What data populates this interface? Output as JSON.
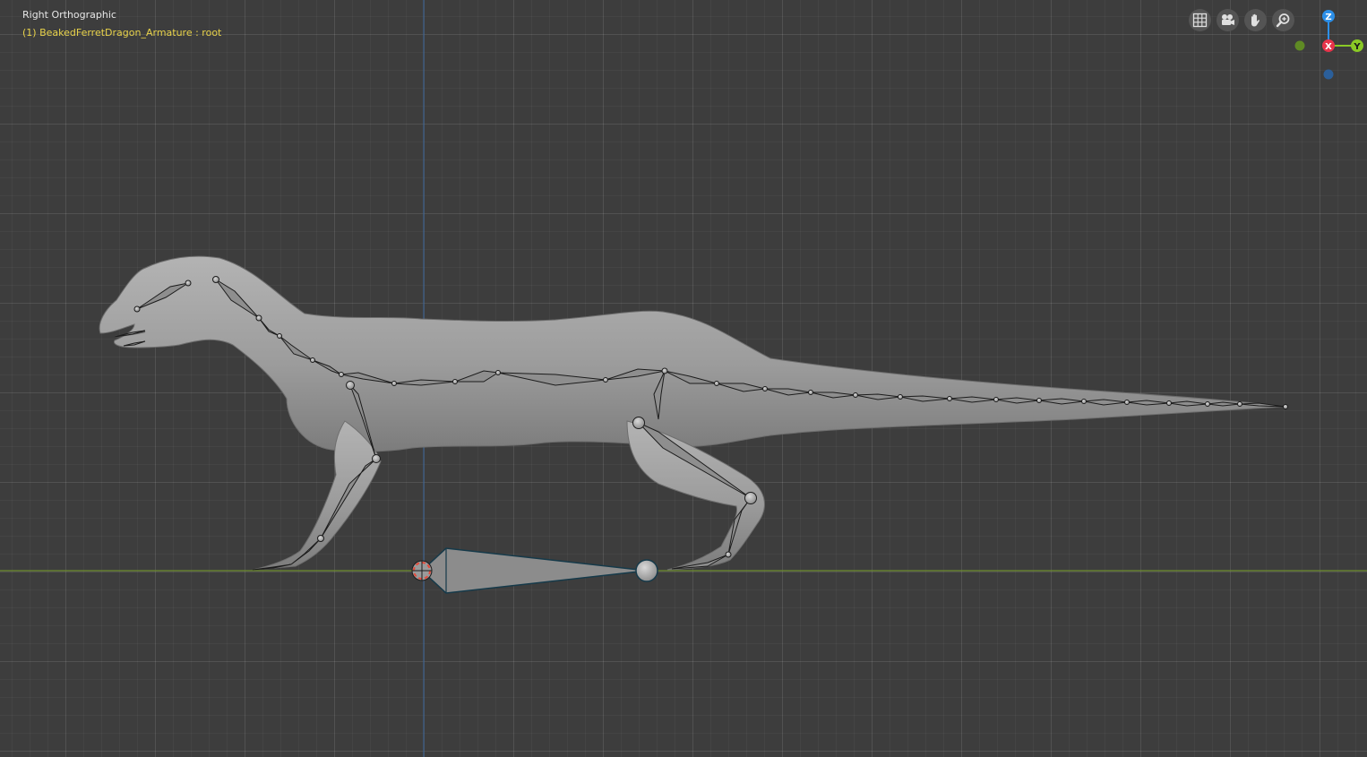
{
  "viewport": {
    "view_name": "Right Orthographic",
    "object_info": "(1) BeakedFerretDragon_Armature : root"
  },
  "nav_buttons": [
    {
      "name": "grid-view-icon"
    },
    {
      "name": "camera-view-icon"
    },
    {
      "name": "pan-hand-icon"
    },
    {
      "name": "zoom-icon"
    }
  ],
  "gizmo": {
    "z_label": "Z",
    "x_label": "X",
    "y_label": "Y",
    "colors": {
      "z": "#2c8fe8",
      "x": "#e8344b",
      "y": "#8ac925",
      "neg_y": "#5f8a24",
      "neg_z": "#2b5f9a"
    }
  },
  "colors": {
    "background": "#3d3d3d",
    "mesh": "#9a9a9a",
    "bone": "#8e8e8e",
    "bone_outline": "#1c1c1c",
    "root_bone_outline": "#163a4a",
    "ground_line": "#6f8e2f",
    "z_axis_line": "#3b5f8a",
    "object_info_text": "#e8d24a"
  }
}
